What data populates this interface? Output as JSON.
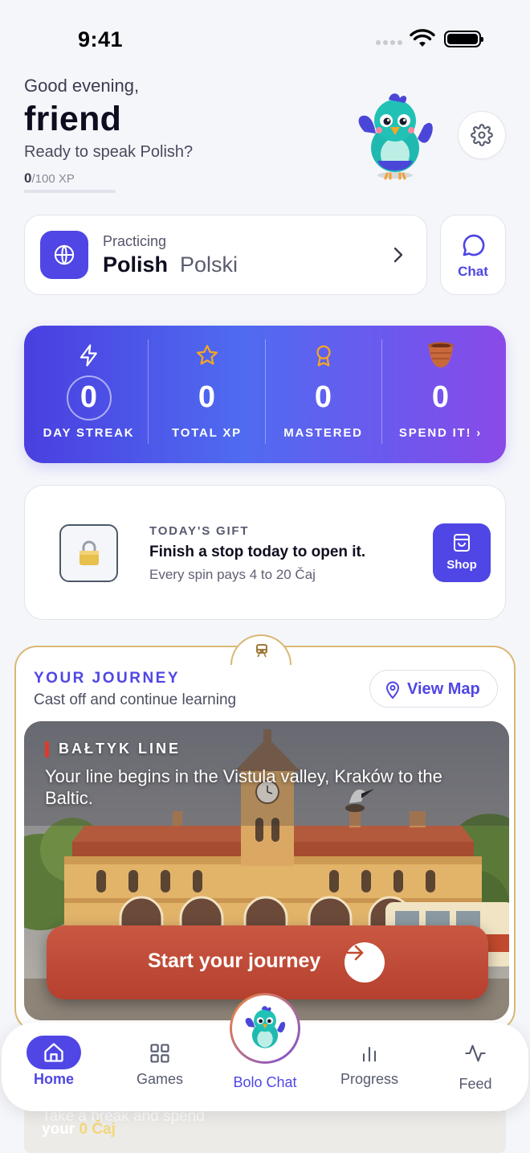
{
  "status_bar": {
    "time": "9:41"
  },
  "header": {
    "greeting": "Good evening,",
    "name": "friend",
    "subtitle": "Ready to speak Polish?",
    "xp_current": "0",
    "xp_total": "/100 XP",
    "xp_progress": 0
  },
  "practice": {
    "label": "Practicing",
    "language": "Polish",
    "native_name": "Polski",
    "chat_label": "Chat"
  },
  "stats": [
    {
      "icon": "lightning-icon",
      "value": "0",
      "caption": "DAY STREAK"
    },
    {
      "icon": "star-icon",
      "value": "0",
      "caption": "TOTAL XP"
    },
    {
      "icon": "medal-icon",
      "value": "0",
      "caption": "MASTERED"
    },
    {
      "icon": "pot-icon",
      "value": "0",
      "caption": "SPEND IT! ›"
    }
  ],
  "gift": {
    "title": "TODAY'S GIFT",
    "main": "Finish a stop today to open it.",
    "sub": "Every spin pays 4 to 20 Čaj",
    "shop_label": "Shop"
  },
  "journey": {
    "title": "YOUR JOURNEY",
    "subtitle": "Cast off and continue learning",
    "view_map": "View Map",
    "line_name": "BAŁTYK LINE",
    "description": "Your line begins in the Vistula valley, Kraków to the Baltic.",
    "start_label": "Start your journey"
  },
  "below": {
    "line1": "Take a break and spend",
    "line2_prefix": "your",
    "line2_value": "0 Čaj"
  },
  "tabbar": {
    "home": "Home",
    "games": "Games",
    "bolo": "Bolo Chat",
    "progress": "Progress",
    "feed": "Feed"
  },
  "colors": {
    "accent": "#4f46e5",
    "journey_border": "#d9b874",
    "start_button": "#b5402e"
  }
}
